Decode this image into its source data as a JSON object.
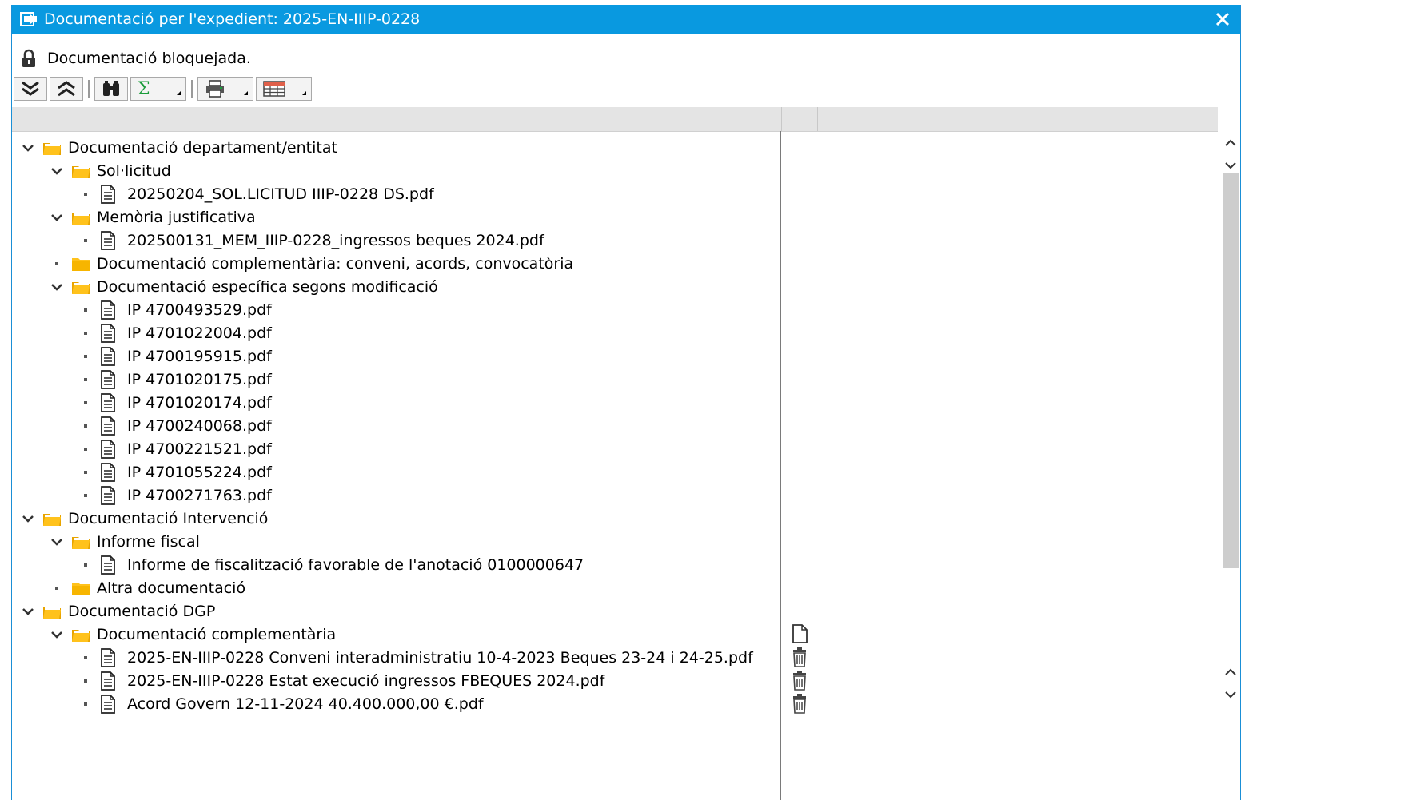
{
  "window": {
    "title": "Documentació per l'expedient: 2025-EN-IIIP-0228"
  },
  "status": {
    "text": "Documentació bloquejada."
  },
  "toolbar": {
    "buttons": [
      "expand-all",
      "collapse-all",
      "find",
      "sum",
      "print",
      "layout"
    ]
  },
  "tree": [
    {
      "level": 0,
      "type": "folder",
      "expanded": true,
      "label": "Documentació departament/entitat"
    },
    {
      "level": 1,
      "type": "folder",
      "expanded": true,
      "label": "Sol·licitud"
    },
    {
      "level": 2,
      "type": "file",
      "label": "20250204_SOL.LICITUD IIIP-0228 DS.pdf"
    },
    {
      "level": 1,
      "type": "folder",
      "expanded": true,
      "label": "Memòria justificativa"
    },
    {
      "level": 2,
      "type": "file",
      "label": "202500131_MEM_IIIP-0228_ingressos beques 2024.pdf"
    },
    {
      "level": 1,
      "type": "folder",
      "expanded": false,
      "label": "Documentació complementària: conveni, acords, convocatòria"
    },
    {
      "level": 1,
      "type": "folder",
      "expanded": true,
      "label": "Documentació específica segons modificació"
    },
    {
      "level": 2,
      "type": "file",
      "label": "IP 4700493529.pdf"
    },
    {
      "level": 2,
      "type": "file",
      "label": "IP 4701022004.pdf"
    },
    {
      "level": 2,
      "type": "file",
      "label": "IP 4700195915.pdf"
    },
    {
      "level": 2,
      "type": "file",
      "label": "IP 4701020175.pdf"
    },
    {
      "level": 2,
      "type": "file",
      "label": "IP 4701020174.pdf"
    },
    {
      "level": 2,
      "type": "file",
      "label": "IP 4700240068.pdf"
    },
    {
      "level": 2,
      "type": "file",
      "label": "IP 4700221521.pdf"
    },
    {
      "level": 2,
      "type": "file",
      "label": "IP 4701055224.pdf"
    },
    {
      "level": 2,
      "type": "file",
      "label": "IP 4700271763.pdf"
    },
    {
      "level": 0,
      "type": "folder",
      "expanded": true,
      "label": "Documentació Intervenció"
    },
    {
      "level": 1,
      "type": "folder",
      "expanded": true,
      "label": "Informe fiscal"
    },
    {
      "level": 2,
      "type": "file",
      "label": "Informe de fiscalització favorable de l'anotació 0100000647"
    },
    {
      "level": 1,
      "type": "folder",
      "expanded": false,
      "label": "Altra documentació"
    },
    {
      "level": 0,
      "type": "folder",
      "expanded": true,
      "label": "Documentació DGP"
    },
    {
      "level": 1,
      "type": "folder",
      "expanded": true,
      "label": "Documentació complementària",
      "action": "new-document-icon"
    },
    {
      "level": 2,
      "type": "file",
      "label": "2025-EN-IIIP-0228 Conveni interadministratiu 10-4-2023 Beques 23-24 i 24-25.pdf",
      "action": "trash-icon"
    },
    {
      "level": 2,
      "type": "file",
      "label": "2025-EN-IIIP-0228 Estat execució ingressos FBEQUES 2024.pdf",
      "action": "trash-icon"
    },
    {
      "level": 2,
      "type": "file",
      "label": "Acord Govern 12-11-2024 40.400.000,00 €.pdf",
      "action": "trash-icon"
    }
  ]
}
